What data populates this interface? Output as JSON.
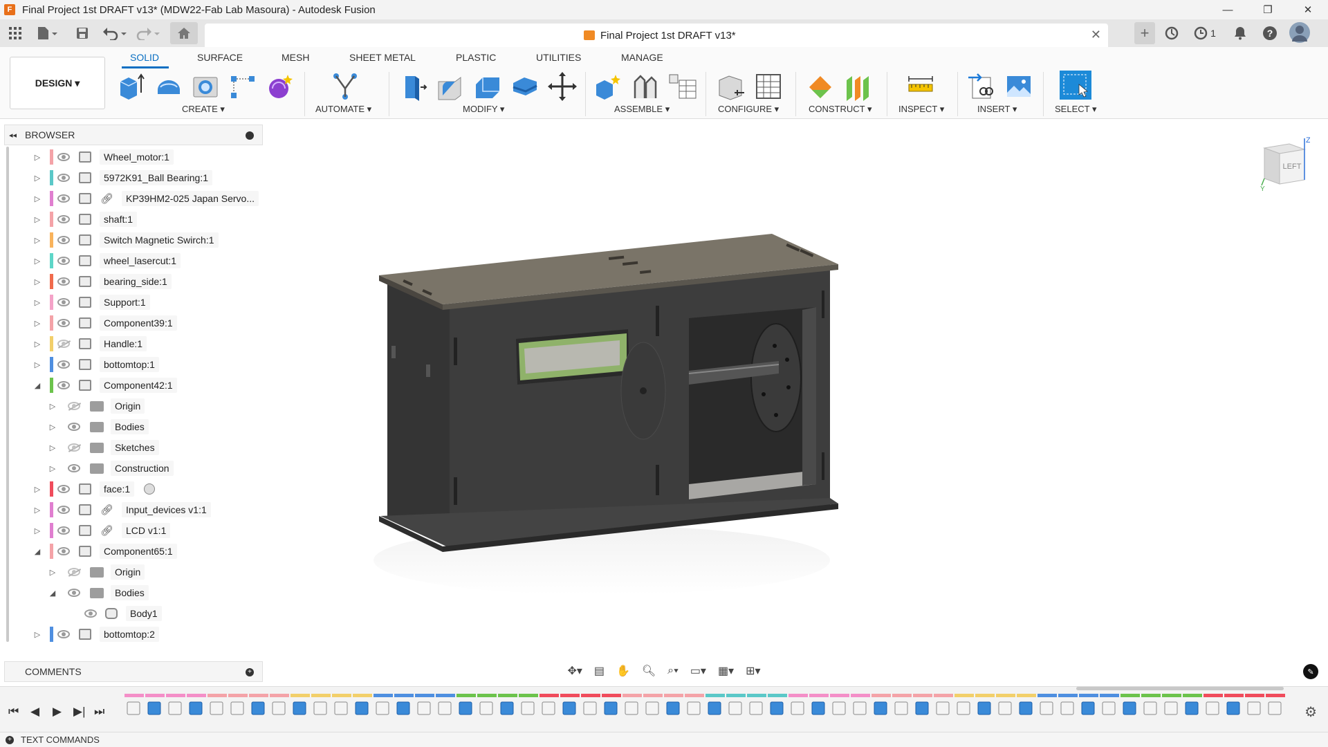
{
  "window": {
    "title": "Final Project 1st DRAFT v13* (MDW22-Fab Lab Masoura) - Autodesk Fusion",
    "app_logo_letter": "F",
    "minimize": "—",
    "restore": "❐",
    "close": "✕"
  },
  "quick_access": {
    "doc_tab_label": "Final Project 1st DRAFT v13*",
    "doc_tab_close": "✕",
    "add_tab": "+",
    "job_count": "1"
  },
  "ribbon": {
    "workspace_label": "DESIGN ▾",
    "tabs": [
      "SOLID",
      "SURFACE",
      "MESH",
      "SHEET METAL",
      "PLASTIC",
      "UTILITIES",
      "MANAGE"
    ],
    "active_tab": "SOLID",
    "groups": [
      "CREATE ▾",
      "AUTOMATE ▾",
      "MODIFY ▾",
      "ASSEMBLE ▾",
      "CONFIGURE ▾",
      "CONSTRUCT ▾",
      "INSPECT ▾",
      "INSERT ▾",
      "SELECT ▾"
    ]
  },
  "browser": {
    "header_label": "BROWSER",
    "collapse_glyph": "◂◂",
    "rows": [
      {
        "label": "Wheel_motor:1",
        "color": "#f4a3a8",
        "expand": "▷",
        "visible": true
      },
      {
        "label": "5972K91_Ball Bearing:1",
        "color": "#5bc8c8",
        "expand": "▷",
        "visible": true
      },
      {
        "label": "KP39HM2-025 Japan Servo...",
        "color": "#e07fd0",
        "expand": "▷",
        "visible": true,
        "linked": true
      },
      {
        "label": "shaft:1",
        "color": "#f4a3a8",
        "expand": "▷",
        "visible": true
      },
      {
        "label": "Switch Magnetic Swirch:1",
        "color": "#f9b35c",
        "expand": "▷",
        "visible": true
      },
      {
        "label": "wheel_lasercut:1",
        "color": "#5ed6c8",
        "expand": "▷",
        "visible": true
      },
      {
        "label": "bearing_side:1",
        "color": "#f06b4c",
        "expand": "▷",
        "visible": true
      },
      {
        "label": "Support:1",
        "color": "#f4a3c8",
        "expand": "▷",
        "visible": true
      },
      {
        "label": "Component39:1",
        "color": "#f4a3a8",
        "expand": "▷",
        "visible": true
      },
      {
        "label": "Handle:1",
        "color": "#f2cf6a",
        "expand": "▷",
        "visible": false
      },
      {
        "label": "bottomtop:1",
        "color": "#4f8fe0",
        "expand": "▷",
        "visible": true
      },
      {
        "label": "Component42:1",
        "color": "#6cc34c",
        "expand": "◢",
        "visible": true
      },
      {
        "label": "Origin",
        "color": "",
        "expand": "▷",
        "visible": false,
        "folder": true,
        "indent": 1
      },
      {
        "label": "Bodies",
        "color": "",
        "expand": "▷",
        "visible": true,
        "folder": true,
        "indent": 1
      },
      {
        "label": "Sketches",
        "color": "",
        "expand": "▷",
        "visible": false,
        "folder": true,
        "indent": 1
      },
      {
        "label": "Construction",
        "color": "",
        "expand": "▷",
        "visible": true,
        "folder": true,
        "indent": 1
      },
      {
        "label": "face:1",
        "color": "#f04c5c",
        "expand": "▷",
        "visible": true,
        "radio": true
      },
      {
        "label": "Input_devices v1:1",
        "color": "#e07fd0",
        "expand": "▷",
        "visible": true,
        "linked": true
      },
      {
        "label": "LCD v1:1",
        "color": "#e07fd0",
        "expand": "▷",
        "visible": true,
        "linked": true
      },
      {
        "label": "Component65:1",
        "color": "#f4a3a8",
        "expand": "◢",
        "visible": true
      },
      {
        "label": "Origin",
        "color": "",
        "expand": "▷",
        "visible": false,
        "folder": true,
        "indent": 1
      },
      {
        "label": "Bodies",
        "color": "",
        "expand": "◢",
        "visible": true,
        "folder": true,
        "indent": 1
      },
      {
        "label": "Body1",
        "color": "",
        "expand": "",
        "visible": true,
        "body": true,
        "indent": 2
      },
      {
        "label": "bottomtop:2",
        "color": "#4f8fe0",
        "expand": "▷",
        "visible": true
      }
    ]
  },
  "comments": {
    "label": "COMMENTS",
    "add_glyph": "+"
  },
  "viewcube": {
    "face_label": "LEFT",
    "axis_z": "Z",
    "axis_y": "Y"
  },
  "timeline": {
    "controls": [
      "⏮",
      "◀",
      "▶",
      "▶|",
      "⏭"
    ],
    "feature_colors": [
      "#f48fc8",
      "#f4a3a8",
      "#f2cf6a",
      "#4f8fe0",
      "#6cc34c",
      "#f04c5c",
      "#f4a3a8",
      "#5bc8c8"
    ]
  },
  "text_commands": {
    "label": "TEXT COMMANDS",
    "toggle_glyph": "+"
  },
  "colors": {
    "accent": "#0a6fc2",
    "model": "#3d3d3d",
    "model_top": "#7a7468",
    "lcd": "#8fb26a"
  }
}
